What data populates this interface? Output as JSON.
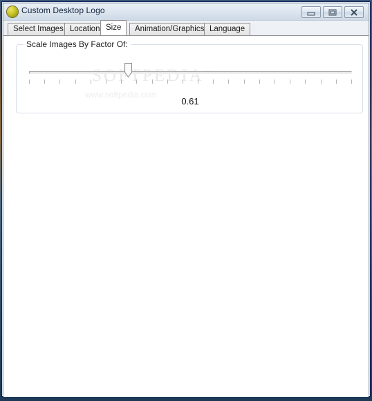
{
  "window": {
    "title": "Custom Desktop Logo",
    "icon": "sphere-logo-icon",
    "controls": {
      "minimize_label": "Minimize",
      "maximize_label": "Maximize",
      "close_label": "Close"
    }
  },
  "tabs": [
    {
      "label": "Select Images",
      "selected": false
    },
    {
      "label": "Location",
      "selected": false
    },
    {
      "label": "Size",
      "selected": true
    },
    {
      "label": "Animation/Graphics",
      "selected": false
    },
    {
      "label": "Language",
      "selected": false
    }
  ],
  "size_tab": {
    "groupbox": {
      "label": "Scale Images By Factor Of:"
    },
    "slider": {
      "value_text": "0.61",
      "value": 0.61,
      "min": 0.0,
      "max": 2.0,
      "tick_count": 22,
      "thumb_position_percent": 30.6
    }
  },
  "watermark": {
    "brand": "SOFTPEDIA",
    "trademark": "™",
    "url": "www.softpedia.com"
  },
  "colors": {
    "window_border": "#16205c",
    "titlebar_top": "#eaf0f6",
    "titlebar_bottom": "#cdd9e6",
    "tab_selected_bg": "#ffffff",
    "tab_bg": "#e4e4e4",
    "page_bg": "#ffffff",
    "groupbox_border": "#d7dfe6",
    "slider_track": "#e9e9e9",
    "tick": "#b4b4b4",
    "watermark": "#e9e9e9"
  }
}
